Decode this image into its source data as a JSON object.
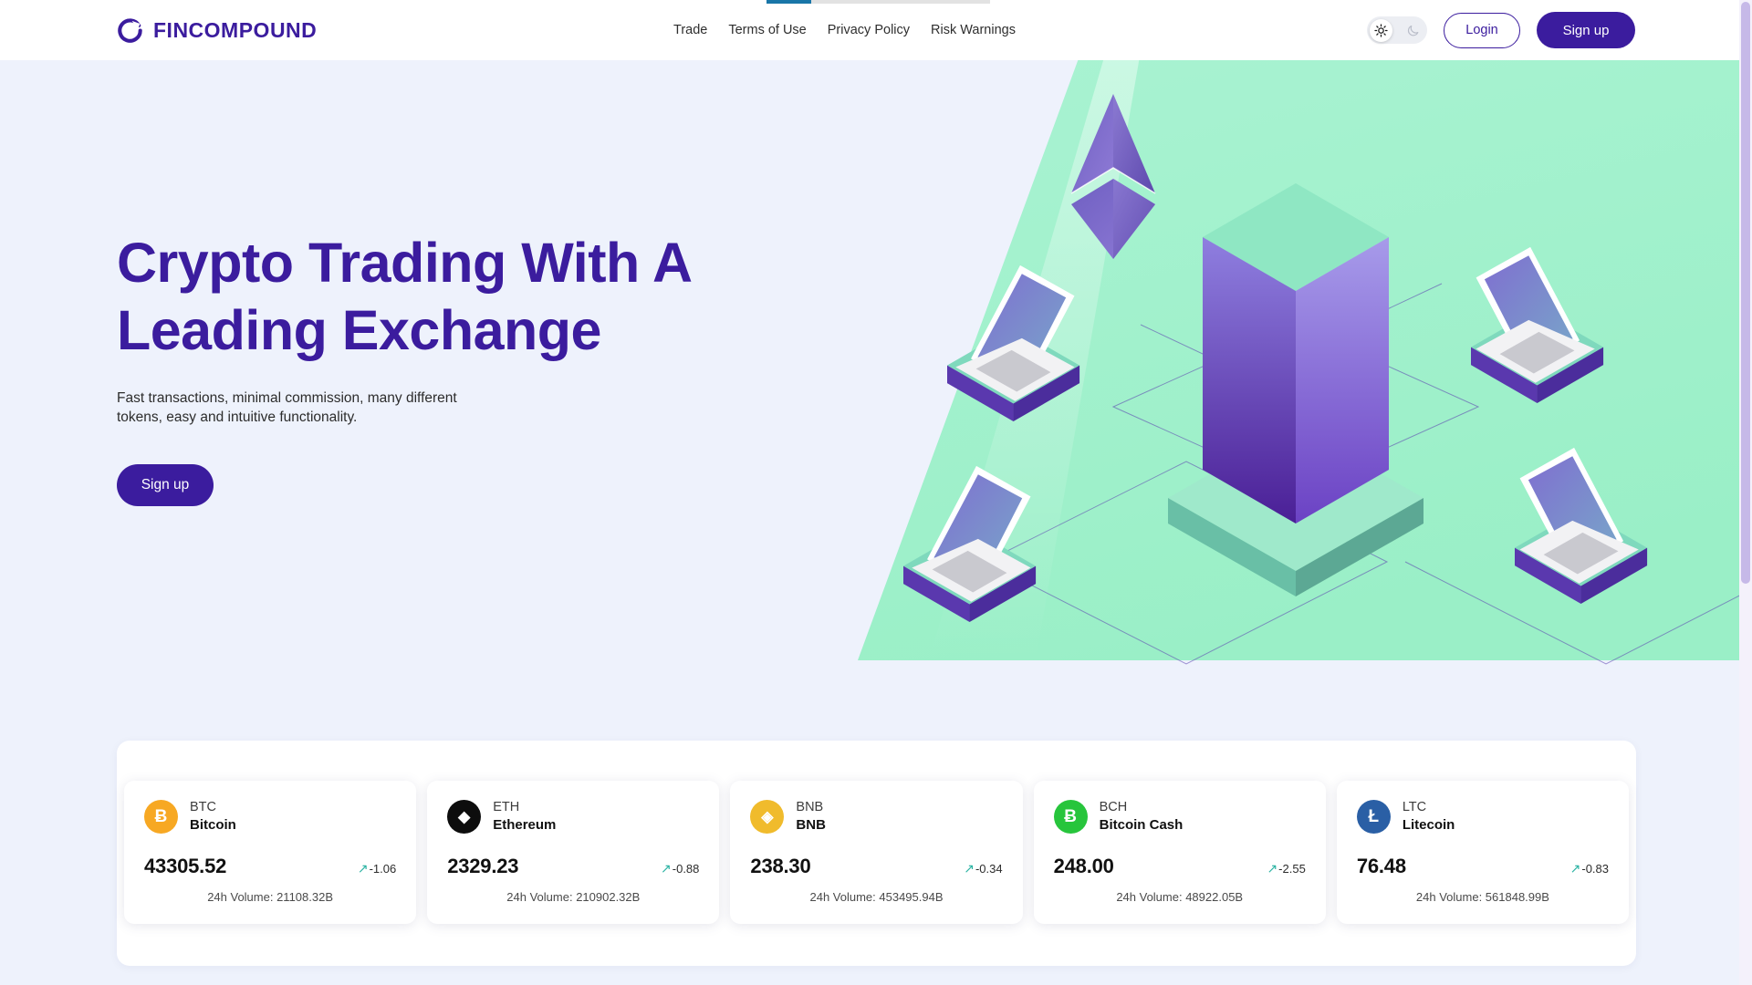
{
  "colors": {
    "brand_purple": "#3b1c9e",
    "page_bg": "#eef2fc",
    "mint": "#9df0c9",
    "accent_teal": "#2bb3a3",
    "load_bar": "#1976a8"
  },
  "loading_bar": {
    "progress_percent": 20
  },
  "header": {
    "logo_text": "FINCOMPOUND",
    "logo_icon": "compound-circle-icon",
    "nav": [
      {
        "label": "Trade"
      },
      {
        "label": "Terms of Use"
      },
      {
        "label": "Privacy Policy"
      },
      {
        "label": "Risk Warnings"
      }
    ],
    "theme_toggle": {
      "light_icon": "sun-icon",
      "dark_icon": "moon-icon",
      "active": "light"
    },
    "login_label": "Login",
    "signup_label": "Sign up"
  },
  "hero": {
    "title_line1": "Crypto Trading With A",
    "title_line2": "Leading Exchange",
    "subtitle": "Fast transactions, minimal commission, many different tokens, easy and intuitive functionality.",
    "cta_label": "Sign up",
    "illustration": "isometric-blockchain-network-laptops"
  },
  "ticker": {
    "volume_prefix": "24h Volume: ",
    "coins": [
      {
        "symbol": "BTC",
        "name": "Bitcoin",
        "price": "43305.52",
        "change": "-1.06",
        "volume": "21108.32B",
        "logo_color": "#f7a823",
        "logo_glyph": "Ƀ",
        "trend_icon": "arrow-up-right-icon"
      },
      {
        "symbol": "ETH",
        "name": "Ethereum",
        "price": "2329.23",
        "change": "-0.88",
        "volume": "210902.32B",
        "logo_color": "#0d0d0d",
        "logo_glyph": "◆",
        "trend_icon": "arrow-up-right-icon"
      },
      {
        "symbol": "BNB",
        "name": "BNB",
        "price": "238.30",
        "change": "-0.34",
        "volume": "453495.94B",
        "logo_color": "#f0bb2c",
        "logo_glyph": "◈",
        "trend_icon": "arrow-up-right-icon"
      },
      {
        "symbol": "BCH",
        "name": "Bitcoin Cash",
        "price": "248.00",
        "change": "-2.55",
        "volume": "48922.05B",
        "logo_color": "#27c53c",
        "logo_glyph": "Ƀ",
        "trend_icon": "arrow-up-right-icon"
      },
      {
        "symbol": "LTC",
        "name": "Litecoin",
        "price": "76.48",
        "change": "-0.83",
        "volume": "561848.99B",
        "logo_color": "#2a5fa5",
        "logo_glyph": "Ł",
        "trend_icon": "arrow-up-right-icon"
      }
    ]
  }
}
